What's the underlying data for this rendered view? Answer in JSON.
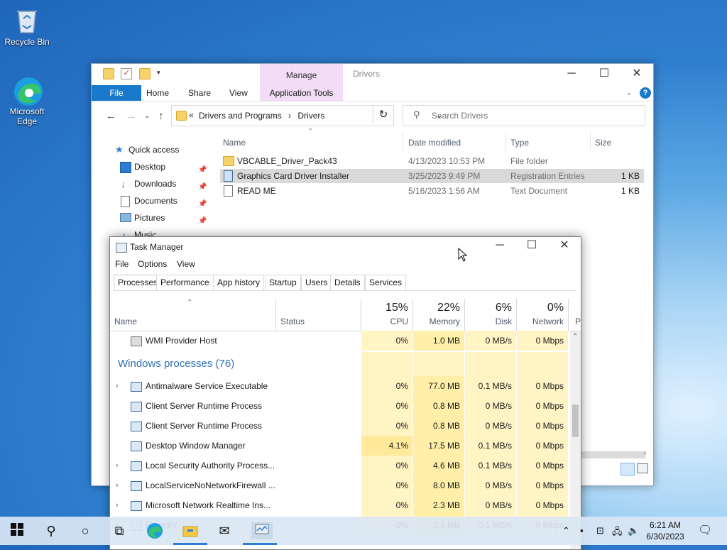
{
  "desktop": {
    "icons": [
      {
        "label": "Recycle Bin"
      },
      {
        "label": "Microsoft\nEdge",
        "line1": "Microsoft",
        "line2": "Edge"
      }
    ]
  },
  "explorer": {
    "title": "Drivers",
    "context_tab": "Manage",
    "ribbon_tabs": [
      "File",
      "Home",
      "Share",
      "View",
      "Application Tools"
    ],
    "address": {
      "prefix": "«",
      "crumbs": [
        "Drivers and Programs",
        "Drivers"
      ],
      "separator": "›"
    },
    "search_placeholder": "Search Drivers",
    "nav": [
      {
        "label": "Quick access",
        "pinned": false
      },
      {
        "label": "Desktop",
        "pinned": true
      },
      {
        "label": "Downloads",
        "pinned": true
      },
      {
        "label": "Documents",
        "pinned": true
      },
      {
        "label": "Pictures",
        "pinned": true
      },
      {
        "label": "Music",
        "pinned": false
      }
    ],
    "columns": [
      "Name",
      "Date modified",
      "Type",
      "Size"
    ],
    "files": [
      {
        "name": "VBCABLE_Driver_Pack43",
        "date": "4/13/2023 10:53 PM",
        "type": "File folder",
        "size": "",
        "kind": "folder"
      },
      {
        "name": "Graphics Card Driver Installer",
        "date": "3/25/2023 9:49 PM",
        "type": "Registration Entries",
        "size": "1 KB",
        "kind": "reg",
        "selected": true
      },
      {
        "name": "READ ME",
        "date": "5/16/2023 1:56 AM",
        "type": "Text Document",
        "size": "1 KB",
        "kind": "txt"
      }
    ]
  },
  "taskmanager": {
    "title": "Task Manager",
    "menu": [
      "File",
      "Options",
      "View"
    ],
    "tabs": [
      "Processes",
      "Performance",
      "App history",
      "Startup",
      "Users",
      "Details",
      "Services"
    ],
    "columns": {
      "name": "Name",
      "status": "Status",
      "cpu": {
        "pct": "15%",
        "label": "CPU"
      },
      "memory": {
        "pct": "22%",
        "label": "Memory"
      },
      "disk": {
        "pct": "6%",
        "label": "Disk"
      },
      "network": {
        "pct": "0%",
        "label": "Network"
      },
      "power": "P"
    },
    "top_row": {
      "name": "WMI Provider Host",
      "cpu": "0%",
      "memory": "1.0 MB",
      "disk": "0 MB/s",
      "network": "0 Mbps"
    },
    "group_label": "Windows processes (76)",
    "rows": [
      {
        "name": "Antimalware Service Executable",
        "expand": true,
        "cpu": "0%",
        "memory": "77.0 MB",
        "disk": "0.1 MB/s",
        "network": "0 Mbps"
      },
      {
        "name": "Client Server Runtime Process",
        "expand": false,
        "cpu": "0%",
        "memory": "0.8 MB",
        "disk": "0 MB/s",
        "network": "0 Mbps"
      },
      {
        "name": "Client Server Runtime Process",
        "expand": false,
        "cpu": "0%",
        "memory": "0.8 MB",
        "disk": "0 MB/s",
        "network": "0 Mbps"
      },
      {
        "name": "Desktop Window Manager",
        "expand": false,
        "cpu": "4.1%",
        "memory": "17.5 MB",
        "disk": "0.1 MB/s",
        "network": "0 Mbps"
      },
      {
        "name": "Local Security Authority Process...",
        "expand": true,
        "cpu": "0%",
        "memory": "4.6 MB",
        "disk": "0.1 MB/s",
        "network": "0 Mbps"
      },
      {
        "name": "LocalServiceNoNetworkFirewall ...",
        "expand": true,
        "cpu": "0%",
        "memory": "8.0 MB",
        "disk": "0 MB/s",
        "network": "0 Mbps"
      },
      {
        "name": "Microsoft Network Realtime Ins...",
        "expand": true,
        "cpu": "0%",
        "memory": "2.3 MB",
        "disk": "0 MB/s",
        "network": "0 Mbps"
      },
      {
        "name": "Registry",
        "expand": true,
        "cpu": "0%",
        "memory": "2.5 MB",
        "disk": "0.1 MB/s",
        "network": "0 Mbps"
      }
    ]
  },
  "taskbar": {
    "clock_time": "6:21 AM",
    "clock_date": "6/30/2023"
  }
}
